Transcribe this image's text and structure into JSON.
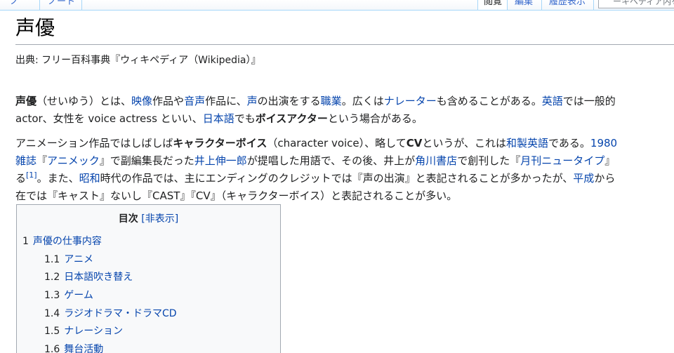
{
  "tabs": {
    "left1": "ノ",
    "left2": "ノート",
    "read": "閲覧",
    "edit": "編集",
    "history": "履歴表示",
    "search_placeholder": "ーキペディア内を検索"
  },
  "article": {
    "title": "声優",
    "from": "出典: フリー百科事典『ウィキペディア（Wikipedia）』"
  },
  "p1": {
    "l1": [
      {
        "t": "声優",
        "b": true
      },
      {
        "t": "（せいゆう）とは、"
      },
      {
        "t": "映像",
        "link": true
      },
      {
        "t": "作品や"
      },
      {
        "t": "音声",
        "link": true
      },
      {
        "t": "作品に、"
      },
      {
        "t": "声",
        "link": true
      },
      {
        "t": "の出演をする"
      },
      {
        "t": "職業",
        "link": true
      },
      {
        "t": "。広くは"
      },
      {
        "t": "ナレーター",
        "link": true
      },
      {
        "t": "も含めることがある。"
      },
      {
        "t": "英語",
        "link": true
      },
      {
        "t": "では一般的"
      }
    ],
    "l2": [
      {
        "t": "actor、女性を voice actress といい、"
      },
      {
        "t": "日本語",
        "link": true
      },
      {
        "t": "でも"
      },
      {
        "t": "ボイスアクター",
        "b": true
      },
      {
        "t": "という場合がある。"
      }
    ]
  },
  "p2": {
    "l1": [
      {
        "t": "アニメーション作品ではしばしば"
      },
      {
        "t": "キャラクターボイス",
        "b": true
      },
      {
        "t": "（character voice）、略して"
      },
      {
        "t": "CV",
        "b": true
      },
      {
        "t": "というが、これは"
      },
      {
        "t": "和製英語",
        "link": true
      },
      {
        "t": "である。"
      },
      {
        "t": "1980",
        "link": true
      }
    ],
    "l2": [
      {
        "t": "雑誌",
        "link": true
      },
      {
        "t": "『"
      },
      {
        "t": "アニメック",
        "link": true
      },
      {
        "t": "』で副編集長だった"
      },
      {
        "t": "井上伸一郎",
        "link": true
      },
      {
        "t": "が提唱した用語で、その後、井上が"
      },
      {
        "t": "角川書店",
        "link": true
      },
      {
        "t": "で創刊した『"
      },
      {
        "t": "月刊ニュータイプ",
        "link": true
      },
      {
        "t": "』"
      }
    ],
    "l3": [
      {
        "t": "る"
      },
      {
        "t": "[1]",
        "link": true,
        "sup": true
      },
      {
        "t": "。また、"
      },
      {
        "t": "昭和",
        "link": true
      },
      {
        "t": "時代の作品では、主にエンディングのクレジットでは『声の出演』と表記されることが多かったが、"
      },
      {
        "t": "平成",
        "link": true
      },
      {
        "t": "から"
      }
    ],
    "l4": [
      {
        "t": "在では『キャスト』ないし『CAST』『CV』（キャラクターボイス）と表記されることが多い。"
      }
    ]
  },
  "toc": {
    "title": "目次",
    "toggle": "[非表示]",
    "items": [
      {
        "num": "1",
        "label": "声優の仕事内容"
      },
      {
        "num": "1.1",
        "label": "アニメ"
      },
      {
        "num": "1.2",
        "label": "日本語吹き替え"
      },
      {
        "num": "1.3",
        "label": "ゲーム"
      },
      {
        "num": "1.4",
        "label": "ラジオドラマ・ドラマCD"
      },
      {
        "num": "1.5",
        "label": "ナレーション"
      },
      {
        "num": "1.6",
        "label": "舞台活動"
      }
    ]
  }
}
